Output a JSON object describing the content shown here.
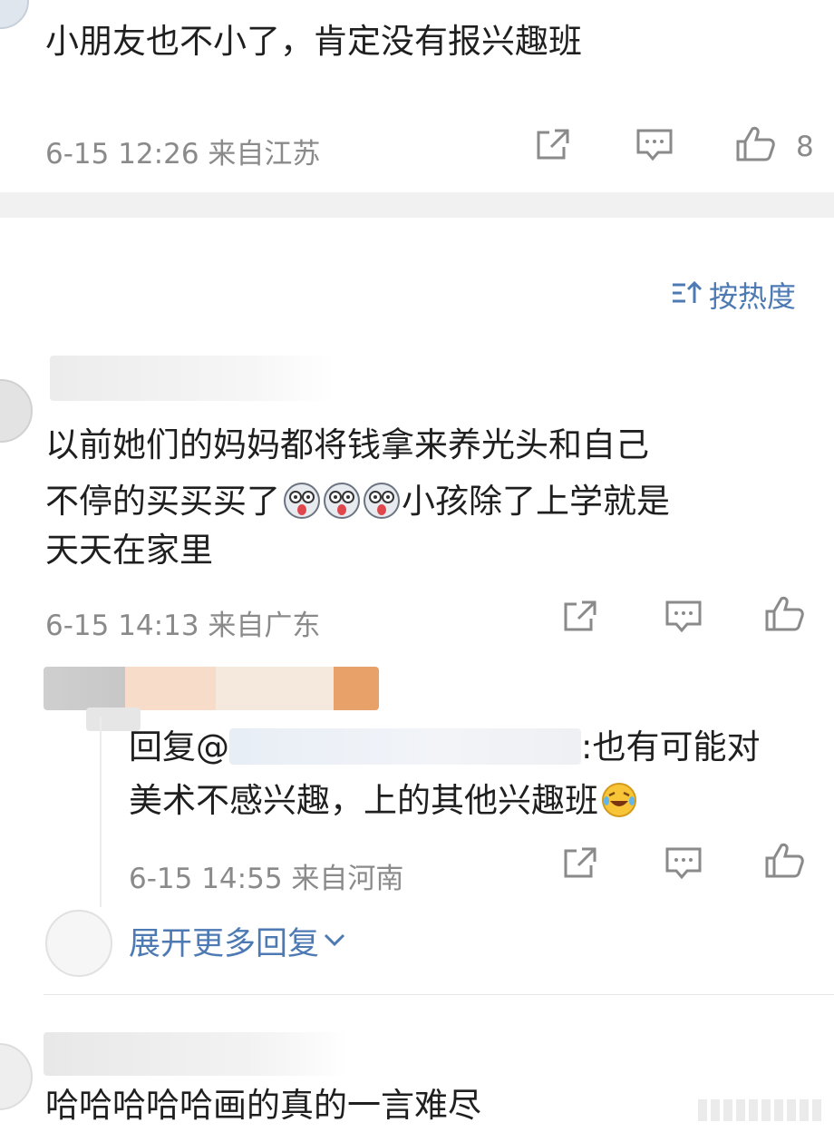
{
  "comment1": {
    "text": "小朋友也不小了，肯定没有报兴趣班",
    "meta": "6-15 12:26 来自江苏",
    "like_count": "8"
  },
  "sort": {
    "label": "按热度"
  },
  "comment2": {
    "line1": "以前她们的妈妈都将钱拿来养光头和自己",
    "line2_before": "不停的买买买了",
    "line2_after": "小孩除了上学就是",
    "line3": "天天在家里",
    "meta": "6-15 14:13 来自广东"
  },
  "reply": {
    "prefix": "回复@",
    "after_mention": ":也有可能对",
    "line2": "美术不感兴趣，上的其他兴趣班",
    "meta": "6-15 14:55 来自河南"
  },
  "expand": {
    "label": "展开更多回复"
  },
  "comment3": {
    "text": "哈哈哈哈哈画的真的一言难尽"
  },
  "icons": {
    "share": "share-icon",
    "comment": "comment-icon",
    "like": "thumbs-up-icon",
    "sort": "sort-icon",
    "chevron": "chevron-down-icon",
    "emoji_funny": "funny-face-emoji-icon",
    "emoji_laugh": "laugh-cry-emoji-icon"
  },
  "colors": {
    "link": "#4e7ab4",
    "meta": "#8a8a8a",
    "text": "#1f1f1f",
    "separator": "#f1f1f1"
  }
}
